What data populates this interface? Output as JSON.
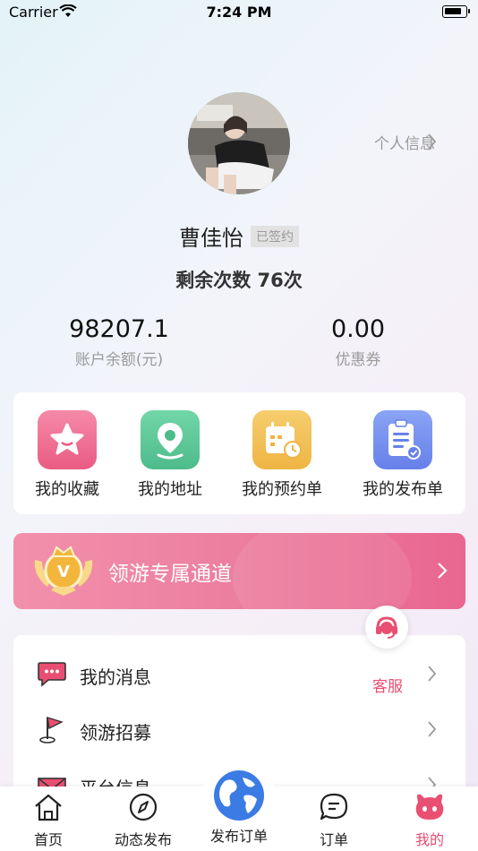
{
  "status_bar": {
    "carrier": "Carrier",
    "time": "7:24 PM"
  },
  "profile": {
    "profile_link": "个人信息",
    "name": "曹佳怡",
    "badge": "已签约",
    "remaining": "剩余次数 76次",
    "balance_value": "98207.1",
    "balance_label": "账户余额(元)",
    "coupon_value": "0.00",
    "coupon_label": "优惠券"
  },
  "quick_actions": [
    {
      "label": "我的收藏",
      "icon": "star-icon",
      "color": "#f07195"
    },
    {
      "label": "我的地址",
      "icon": "location-pin-icon",
      "color": "#5ec89a"
    },
    {
      "label": "我的预约单",
      "icon": "calendar-clock-icon",
      "color": "#f2c15c"
    },
    {
      "label": "我的发布单",
      "icon": "clipboard-check-icon",
      "color": "#6f8ff0"
    }
  ],
  "banner": {
    "text": "领游专属通道"
  },
  "menu": [
    {
      "label": "我的消息",
      "icon": "message-icon"
    },
    {
      "label": "领游招募",
      "icon": "flag-icon"
    },
    {
      "label": "平台信息",
      "icon": "mail-icon"
    }
  ],
  "service_label": "客服",
  "tabs": [
    {
      "label": "首页",
      "icon": "home-icon",
      "active": false
    },
    {
      "label": "动态发布",
      "icon": "compass-icon",
      "active": false
    },
    {
      "label": "发布订单",
      "icon": "globe-icon",
      "active": false
    },
    {
      "label": "订单",
      "icon": "chat-order-icon",
      "active": false
    },
    {
      "label": "我的",
      "icon": "mine-face-icon",
      "active": true
    }
  ],
  "colors": {
    "accent": "#e84d72",
    "banner": "#ec7ea0"
  }
}
